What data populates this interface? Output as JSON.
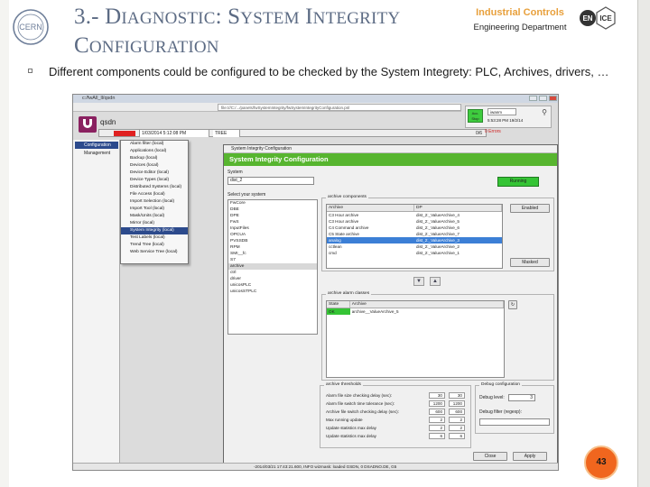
{
  "slide": {
    "title_lead": "3.- D",
    "title_part_1": "IAGNOSTIC",
    "title_colon": ": S",
    "title_part_2": "YSTEM",
    "title_i": " I",
    "title_part_3": "NTEGRITY",
    "title_c": "C",
    "title_part_4": "ONFIGURATION",
    "header_group": "Industrial Controls",
    "header_dept": "Engineering Department",
    "bullet": "Different components could be configured to be checked by the System Integrety: PLC, Archives, drivers, …",
    "page_number": "43",
    "colors": {
      "title": "#5c6b84",
      "industrial_controls": "#e8a03c",
      "page_badge": "#f0661e",
      "dialog_header": "#57b52f",
      "selection": "#2c4a8c"
    },
    "icons": [
      "cern-logo",
      "en-ice-logo"
    ]
  },
  "screenshot": {
    "window_title": "c:/fwAll_ll/qsdn",
    "url": "file:///C:/.../panels/fwSystemIntegrity/fwSystemIntegrityConfiguration.pnl",
    "app_name": "qsdn",
    "user_panel": {
      "status": "Acc. Stop",
      "user": "iwanm",
      "time": "5:53:28 PM 19/2/14"
    },
    "status_date": "1/03/2014 5:12:08 PM",
    "status_tree": "TREE",
    "status_page": "0/6",
    "status_alarm": "0 Errors",
    "nav": [
      {
        "label": "Configuration",
        "selected": true
      },
      {
        "label": "Management",
        "selected": false
      }
    ],
    "menu": [
      "Alarm filter (local)",
      "Applications (local)",
      "Backup (local)",
      "Devices (local)",
      "Device Editor (local)",
      "Device Types (local)",
      "Distributed Systems (local)",
      "File Access (local)",
      "Import Selection (local)",
      "Import Tool (local)",
      "Mask/Units (local)",
      "Mirror (local)",
      "System Integrity (local)",
      "Test Labels (local)",
      "Trend Tree (local)",
      "Web Service Tree (local)"
    ],
    "menu_selected_index": 12,
    "dialog": {
      "window_title": "System Integrity Configuration",
      "header": "System Integrity Configuration",
      "system_label": "System",
      "system_value": "dist_2",
      "running_label": "Running",
      "select_label": "Select your system",
      "components": [
        "FwCore",
        "DBE",
        "DPE",
        "FwS",
        "InputFiles",
        "OPCUA",
        "PVSSDB",
        "RPM",
        "SMI__fc",
        "S7",
        "archive",
        "ctrl",
        "driver",
        "unicosPLC",
        "unicosSTPLC"
      ],
      "components_selected_index": 10,
      "archive_components_title": "archive components",
      "archive_headers": [
        "Archive",
        "DP"
      ],
      "archives": [
        {
          "name": "C3 Hour archive",
          "dp": "dist_2:_ValueArchive_4"
        },
        {
          "name": "C3 Hour archive",
          "dp": "dist_2:_ValueArchive_5"
        },
        {
          "name": "C4 Command archive",
          "dp": "dist_2:_ValueArchive_6"
        },
        {
          "name": "C5 State archive",
          "dp": "dist_2:_ValueArchive_7"
        },
        {
          "name": "analog",
          "dp": "dist_2:_ValueArchive_3"
        },
        {
          "name": "cctlean",
          "dp": "dist_2:_ValueArchive_2"
        },
        {
          "name": "cmd",
          "dp": "dist_2:_ValueArchive_1"
        }
      ],
      "archives_selected_index": 4,
      "btn_enabled": "Enabled",
      "btn_masked": "Masked",
      "alarm_classes_title": "archive alarm classes",
      "alarm_headers": [
        "State",
        "Archive"
      ],
      "alarm_rows": [
        {
          "state": "OK",
          "archive": "archive__ValueArchive_5"
        }
      ],
      "thresholds_title": "archive thresholds",
      "thresholds": [
        {
          "label": "Alarm file size checking delay (sec):",
          "a": "30",
          "b": "30"
        },
        {
          "label": "Alarm file switch time tolerance (sec):",
          "a": "1200",
          "b": "1200"
        },
        {
          "label": "Archive file switch checking delay (sec):",
          "a": "600",
          "b": "600"
        },
        {
          "label": "Max running update",
          "a": "2",
          "b": "2"
        },
        {
          "label": "Update statistics max delay",
          "a": "2",
          "b": "2"
        },
        {
          "label": "Update statistics max delay",
          "a": "6",
          "b": "6"
        }
      ],
      "debug_title": "Debug configuration",
      "debug_level_label": "Debug level:",
      "debug_level": "3",
      "debug_filter_label": "Debug filter (regexp):",
      "btn_close": "Close",
      "btn_apply": "Apply"
    },
    "bottom_status": "-2014/03/21 17:43:21.600, INFO          wizmask: loaded GSDN, 0 DSADNO.DE, G5"
  }
}
